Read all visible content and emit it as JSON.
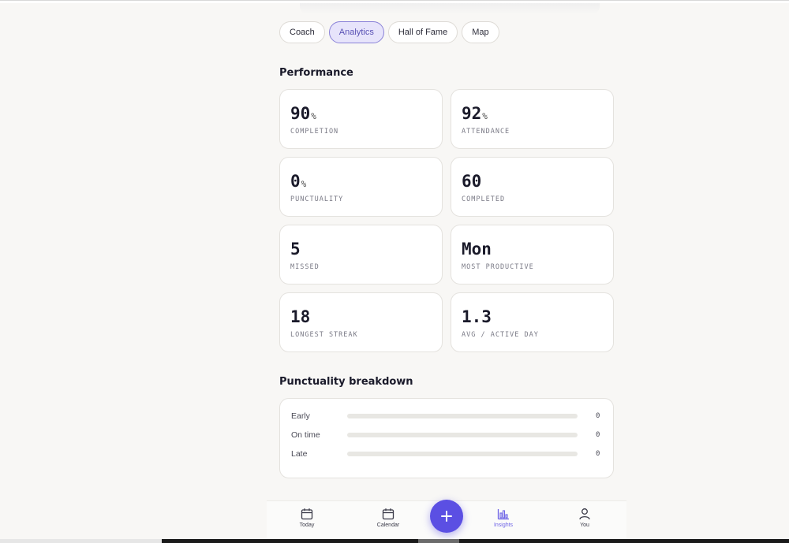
{
  "tabs": [
    {
      "label": "Coach",
      "active": false
    },
    {
      "label": "Analytics",
      "active": true
    },
    {
      "label": "Hall of Fame",
      "active": false
    },
    {
      "label": "Map",
      "active": false
    }
  ],
  "performance": {
    "title": "Performance",
    "stats": [
      {
        "value": "90",
        "unit": "%",
        "label": "COMPLETION"
      },
      {
        "value": "92",
        "unit": "%",
        "label": "ATTENDANCE"
      },
      {
        "value": "0",
        "unit": "%",
        "label": "PUNCTUALITY"
      },
      {
        "value": "60",
        "unit": "",
        "label": "COMPLETED"
      },
      {
        "value": "5",
        "unit": "",
        "label": "MISSED"
      },
      {
        "value": "Mon",
        "unit": "",
        "label": "MOST PRODUCTIVE"
      },
      {
        "value": "18",
        "unit": "",
        "label": "LONGEST STREAK"
      },
      {
        "value": "1.3",
        "unit": "",
        "label": "AVG / ACTIVE DAY"
      }
    ]
  },
  "punctuality": {
    "title": "Punctuality breakdown",
    "rows": [
      {
        "label": "Early",
        "count": "0",
        "fraction": 0
      },
      {
        "label": "On time",
        "count": "0",
        "fraction": 0
      },
      {
        "label": "Late",
        "count": "0",
        "fraction": 0
      }
    ]
  },
  "nav": {
    "today": {
      "label": "Today",
      "icon": "calendar-icon"
    },
    "calendar": {
      "label": "Calendar",
      "icon": "calendar-icon"
    },
    "add": {
      "icon": "plus-icon"
    },
    "insights": {
      "label": "Insights",
      "icon": "bar-chart-icon",
      "active": true
    },
    "you": {
      "label": "You",
      "icon": "user-icon"
    }
  },
  "colors": {
    "accent": "#5b4fe3",
    "active_tab_bg": "#e7e4fb",
    "page_bg": "#f8f7f5"
  }
}
